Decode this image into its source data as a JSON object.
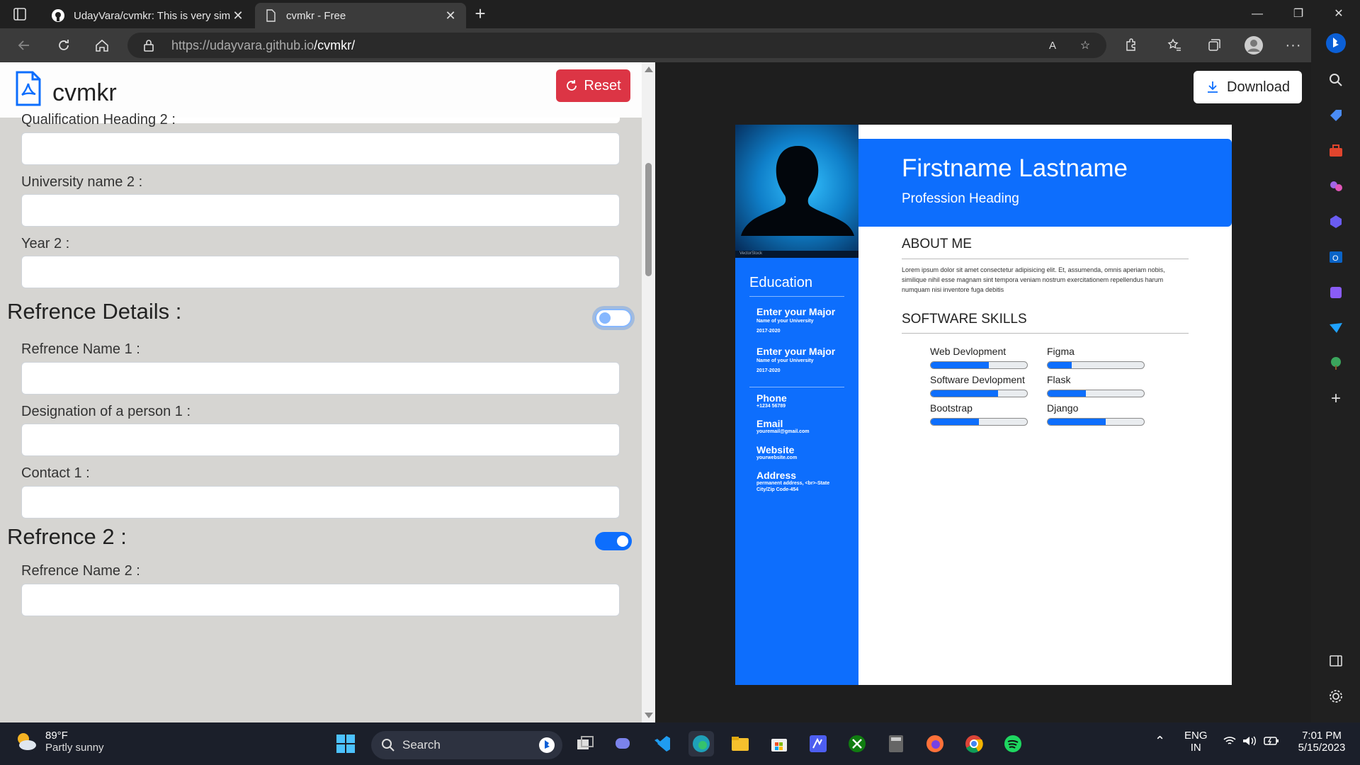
{
  "browser": {
    "tabs": [
      {
        "title": "UdayVara/cvmkr: This is very simple",
        "active": false
      },
      {
        "title": "cvmkr - Free",
        "active": true
      }
    ],
    "url_host": "https://udayvara.github.io",
    "url_path": "/cvmkr/"
  },
  "app": {
    "title": "cvmkr",
    "reset_label": "Reset",
    "download_label": "Download"
  },
  "form": {
    "qualification_heading_2_label": "Qualification Heading 2 :",
    "university_name_2_label": "University name 2 :",
    "year_2_label": "Year 2 :",
    "reference_details_heading": "Refrence Details :",
    "reference_details_enabled": false,
    "reference_name_1_label": "Refrence Name 1 :",
    "designation_1_label": "Designation of a person 1 :",
    "contact_1_label": "Contact 1 :",
    "reference_2_heading": "Refrence 2 :",
    "reference_2_enabled": true,
    "reference_name_2_label": "Refrence Name 2 :"
  },
  "cv": {
    "name": "Firstname Lastname",
    "profession": "Profession Heading",
    "photo_watermark": "VectorStock",
    "education_heading": "Education",
    "education": [
      {
        "major": "Enter your Major",
        "university": "Name of your University",
        "years": "2017-2020"
      },
      {
        "major": "Enter your Major",
        "university": "Name of your University",
        "years": "2017-2020"
      }
    ],
    "contact": {
      "phone_label": "Phone",
      "phone": "+1234 56789",
      "email_label": "Email",
      "email": "youremail@gmail.com",
      "website_label": "Website",
      "website": "yourwebsite.com",
      "address_label": "Address",
      "address_line1": "permanent address, <br>-State",
      "address_line2": "City/Zip Code-454"
    },
    "about_heading": "ABOUT ME",
    "about_text": "Lorem ipsum dolor sit amet consectetur adipisicing elit. Et, assumenda, omnis aperiam nobis, similique nihil esse magnam sint tempora veniam nostrum exercitationem repellendus harum numquam nisi inventore fuga debitis",
    "skills_heading": "SOFTWARE SKILLS",
    "skills": [
      {
        "name": "Web Devlopment",
        "level": 0.6
      },
      {
        "name": "Figma",
        "level": 0.25
      },
      {
        "name": "Software Devlopment",
        "level": 0.7
      },
      {
        "name": "Flask",
        "level": 0.4
      },
      {
        "name": "Bootstrap",
        "level": 0.5
      },
      {
        "name": "Django",
        "level": 0.6
      }
    ]
  },
  "taskbar": {
    "temperature": "89°F",
    "weather": "Partly sunny",
    "search_label": "Search",
    "lang1": "ENG",
    "lang2": "IN",
    "time": "7:01 PM",
    "date": "5/15/2023"
  }
}
